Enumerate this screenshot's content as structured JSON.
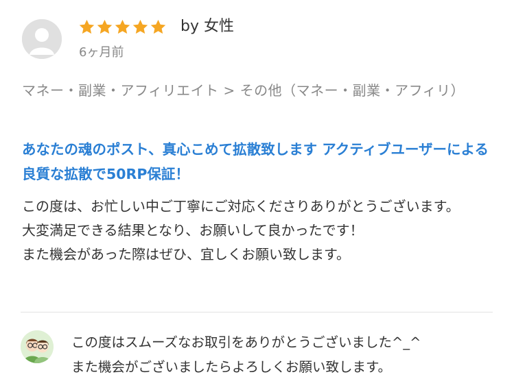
{
  "review": {
    "rating": 5,
    "max_rating": 5,
    "star_color": "#f5a623",
    "by_label": "by 女性",
    "date": "6ヶ月前",
    "category": "マネー・副業・アフィリエイト > その他（マネー・副業・アフィリ）",
    "service_title": "あなたの魂のポスト、真心こめて拡散致します アクティブユーザーによる良質な拡散で50RP保証！",
    "title_color": "#2a7fd4",
    "body": "この度は、お忙しい中ご丁寧にご対応くださりありがとうございます。\n大変満足できる結果となり、お願いして良かったです！\nまた機会があった際はぜひ、宜しくお願い致します。"
  },
  "reply": {
    "text": "この度はスムーズなお取引をありがとうございました^_^\nまた機会がございましたらよろしくお願い致します。"
  },
  "icons": {
    "reviewer_avatar": "default-user-avatar-icon",
    "seller_avatar": "seller-avatar-icon",
    "star": "star-icon"
  }
}
